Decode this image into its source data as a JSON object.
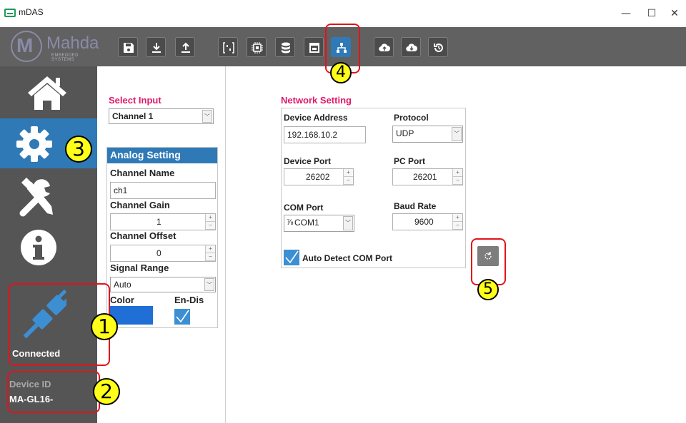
{
  "window": {
    "title": "mDAS",
    "minimize": "—",
    "maximize": "☐",
    "close": "✕"
  },
  "logo": {
    "name": "Mahda",
    "tagline": "EMBEDDED SYSTEMS"
  },
  "toolbar": {
    "buttons": [
      {
        "icon": "save-icon"
      },
      {
        "icon": "download-icon"
      },
      {
        "icon": "upload-icon"
      },
      {
        "icon": "channel-config-icon"
      },
      {
        "icon": "chip-icon"
      },
      {
        "icon": "database-icon"
      },
      {
        "icon": "calendar-icon"
      },
      {
        "icon": "network-icon",
        "active": true
      },
      {
        "icon": "cloud-upload-icon"
      },
      {
        "icon": "cloud-download-icon"
      },
      {
        "icon": "history-icon"
      }
    ]
  },
  "sidebar": {
    "items": [
      {
        "icon": "home-icon"
      },
      {
        "icon": "settings-gear-icon",
        "active": true
      },
      {
        "icon": "tools-icon"
      },
      {
        "icon": "info-icon"
      }
    ],
    "connection": {
      "icon": "plug-icon",
      "status": "Connected"
    },
    "device": {
      "label": "Device ID",
      "value": "MA-GL16-"
    }
  },
  "select_input": {
    "label": "Select Input",
    "value": "Channel 1"
  },
  "analog": {
    "header": "Analog Setting",
    "channel_name_label": "Channel Name",
    "channel_name_value": "ch1",
    "gain_label": "Channel Gain",
    "gain_value": "1",
    "offset_label": "Channel Offset",
    "offset_value": "0",
    "signal_range_label": "Signal Range",
    "signal_range_value": "Auto",
    "color_label": "Color",
    "color_value": "#1f6fd6",
    "endis_label": "En-Dis",
    "endis_checked": true
  },
  "network": {
    "title": "Network Setting",
    "device_address_label": "Device Address",
    "device_address_value": "192.168.10.2",
    "protocol_label": "Protocol",
    "protocol_value": "UDP",
    "device_port_label": "Device Port",
    "device_port_value": "26202",
    "pc_port_label": "PC Port",
    "pc_port_value": "26201",
    "com_port_label": "COM Port",
    "com_port_value": "COM1",
    "baud_rate_label": "Baud Rate",
    "baud_rate_value": "9600",
    "auto_detect_label": "Auto Detect COM Port",
    "auto_detect_checked": true
  },
  "callouts": [
    "1",
    "2",
    "3",
    "4",
    "5"
  ],
  "colors": {
    "accent": "#2f7ab6",
    "sidebar": "#555555",
    "toolbar": "#616161",
    "red_label": "#e0186c",
    "callout_border": "#e0141c",
    "callout_fill": "#ffff1a"
  }
}
